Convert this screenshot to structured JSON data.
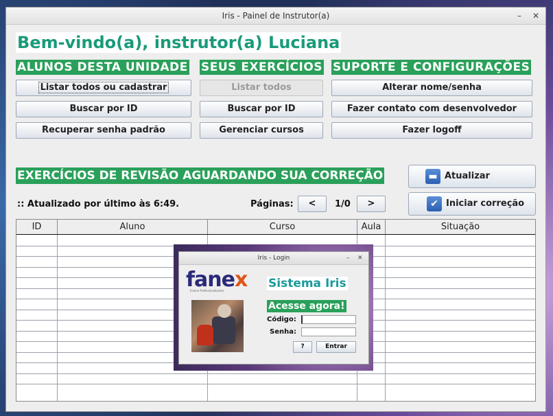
{
  "window": {
    "title": "Iris - Painel de Instrutor(a)",
    "minimize": "–",
    "close": "✕"
  },
  "welcome": "Bem-vindo(a), instrutor(a) Luciana",
  "sections": {
    "students": {
      "title": "ALUNOS DESTA UNIDADE",
      "buttons": [
        "Listar todos ou cadastrar",
        "Buscar por ID",
        "Recuperar senha padrão"
      ]
    },
    "exercises": {
      "title": "SEUS EXERCÍCIOS",
      "buttons": [
        "Listar todos",
        "Buscar por ID",
        "Gerenciar cursos"
      ]
    },
    "support": {
      "title": "SUPORTE E CONFIGURAÇÕES",
      "buttons": [
        "Alterar nome/senha",
        "Fazer contato com desenvolvedor",
        "Fazer logoff"
      ]
    }
  },
  "review": {
    "title": "EXERCÍCIOS DE REVISÃO AGUARDANDO SUA CORREÇÃO",
    "status": ":: Atualizado por último às 6:49.",
    "pages_label": "Páginas:",
    "prev": "<",
    "next": ">",
    "page_count": "1/0",
    "refresh_button": "Atualizar",
    "start_button": "Iniciar correção",
    "columns": [
      "ID",
      "Aluno",
      "Curso",
      "Aula",
      "Situação"
    ]
  },
  "login": {
    "window_title": "Iris - Login",
    "logo": "fanex",
    "logo_tagline": "Ensino Profissionalizante",
    "system_title": "Sistema Iris",
    "access": "Acesse agora!",
    "code_label": "Código:",
    "password_label": "Senha:",
    "help_button": "?",
    "enter_button": "Entrar"
  },
  "colors": {
    "accent_green": "#2aa05a",
    "teal_text": "#1a9a7a",
    "brand_blue": "#2b2a7a",
    "brand_orange": "#e0561a"
  }
}
